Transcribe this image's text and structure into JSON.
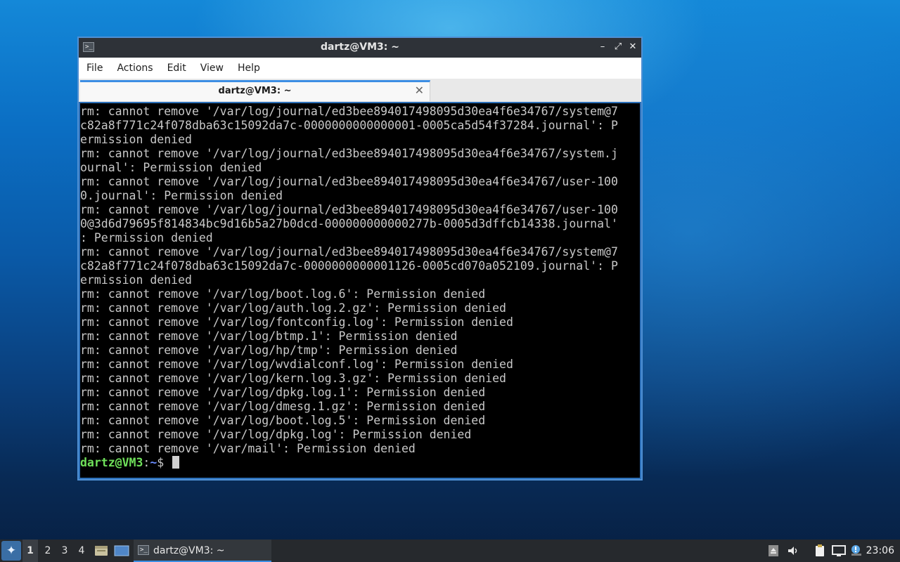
{
  "window": {
    "title": "dartz@VM3: ~",
    "icon": "terminal-icon",
    "minimize_glyph": "–",
    "maximize_glyph": "⤢",
    "close_glyph": "✕"
  },
  "menu": {
    "items": [
      "File",
      "Actions",
      "Edit",
      "View",
      "Help"
    ]
  },
  "tabs": [
    {
      "label": "dartz@VM3: ~",
      "active": true,
      "close_glyph": "✕"
    }
  ],
  "terminal": {
    "lines": [
      "rm: cannot remove '/var/log/journal/ed3bee894017498095d30ea4f6e34767/system@7",
      "c82a8f771c24f078dba63c15092da7c-0000000000000001-0005ca5d54f37284.journal': P",
      "ermission denied",
      "rm: cannot remove '/var/log/journal/ed3bee894017498095d30ea4f6e34767/system.j",
      "ournal': Permission denied",
      "rm: cannot remove '/var/log/journal/ed3bee894017498095d30ea4f6e34767/user-100",
      "0.journal': Permission denied",
      "rm: cannot remove '/var/log/journal/ed3bee894017498095d30ea4f6e34767/user-100",
      "0@3d6d79695f814834bc9d16b5a27b0dcd-000000000000277b-0005d3dffcb14338.journal'",
      ": Permission denied",
      "rm: cannot remove '/var/log/journal/ed3bee894017498095d30ea4f6e34767/system@7",
      "c82a8f771c24f078dba63c15092da7c-0000000000001126-0005cd070a052109.journal': P",
      "ermission denied",
      "rm: cannot remove '/var/log/boot.log.6': Permission denied",
      "rm: cannot remove '/var/log/auth.log.2.gz': Permission denied",
      "rm: cannot remove '/var/log/fontconfig.log': Permission denied",
      "rm: cannot remove '/var/log/btmp.1': Permission denied",
      "rm: cannot remove '/var/log/hp/tmp': Permission denied",
      "rm: cannot remove '/var/log/wvdialconf.log': Permission denied",
      "rm: cannot remove '/var/log/kern.log.3.gz': Permission denied",
      "rm: cannot remove '/var/log/dpkg.log.1': Permission denied",
      "rm: cannot remove '/var/log/dmesg.1.gz': Permission denied",
      "rm: cannot remove '/var/log/boot.log.5': Permission denied",
      "rm: cannot remove '/var/log/dpkg.log': Permission denied",
      "rm: cannot remove '/var/mail': Permission denied"
    ],
    "prompt": {
      "user_host": "dartz@VM3",
      "separator": ":",
      "path": "~",
      "symbol": "$ "
    },
    "colors": {
      "background": "#000000",
      "text": "#c8c8c8",
      "prompt_user": "#6fe05a",
      "prompt_path": "#6a8cff"
    }
  },
  "taskbar": {
    "start_icon": "lubuntu-start-icon",
    "workspaces": [
      "1",
      "2",
      "3",
      "4"
    ],
    "active_workspace": "1",
    "quicklaunch": [
      "file-manager-icon",
      "show-desktop-icon"
    ],
    "tasks": [
      {
        "label": "dartz@VM3: ~",
        "icon": "terminal-icon"
      }
    ],
    "tray": [
      "eject-icon",
      "volume-icon",
      "clipboard-icon",
      "network-icon",
      "update-notifier-icon"
    ],
    "clock": "23:06"
  }
}
